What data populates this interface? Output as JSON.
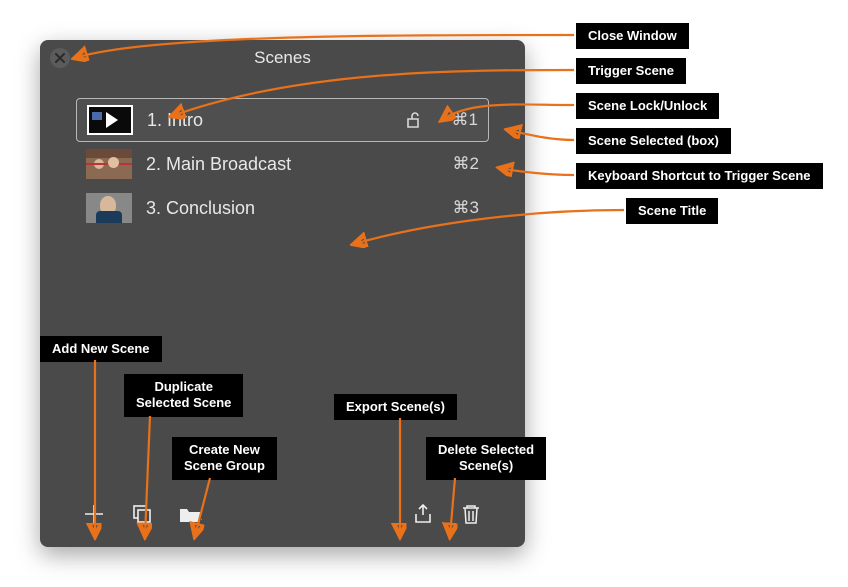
{
  "panel": {
    "title": "Scenes"
  },
  "scenes": [
    {
      "title": "1. Intro",
      "shortcut": "⌘1",
      "locked": false,
      "selected": true,
      "thumb": "play"
    },
    {
      "title": "2. Main Broadcast",
      "shortcut": "⌘2",
      "locked": null,
      "selected": false,
      "thumb": "people"
    },
    {
      "title": "3. Conclusion",
      "shortcut": "⌘3",
      "locked": null,
      "selected": false,
      "thumb": "face"
    }
  ],
  "toolbar": {
    "add": "Add New Scene",
    "duplicate": "Duplicate Selected Scene",
    "group": "Create New Scene Group",
    "export": "Export Scene(s)",
    "delete": "Delete Selected Scene(s)"
  },
  "annotations": {
    "close": "Close Window",
    "trigger": "Trigger Scene",
    "lock": "Scene Lock/Unlock",
    "selected": "Scene Selected (box)",
    "shortcut": "Keyboard Shortcut to Trigger Scene",
    "title": "Scene Title",
    "add": "Add New Scene",
    "duplicate": "Duplicate\nSelected Scene",
    "group": "Create New\nScene Group",
    "export": "Export Scene(s)",
    "delete": "Delete Selected\nScene(s)"
  }
}
